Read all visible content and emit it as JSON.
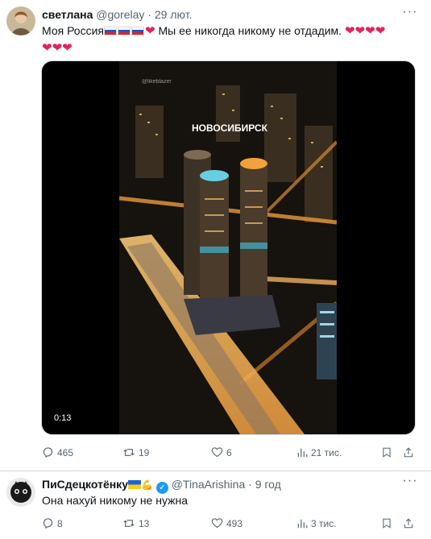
{
  "tweet1": {
    "name": "светлана",
    "handle": "@gorelay",
    "dot": "·",
    "time": "29 лют.",
    "text_part1": "Моя Россия",
    "text_part2": " Мы ее никогда никому не отдадим.",
    "media": {
      "city_label": "НОВОСИБИРСК",
      "watermark": "@likeblazer",
      "timer": "0:13"
    },
    "stats": {
      "replies": "465",
      "retweets": "19",
      "likes": "6",
      "views": "21 тис."
    }
  },
  "tweet2": {
    "name": "ПиСдецкотёнку",
    "handle": "@TinaArishina",
    "dot": "·",
    "time": "9 год",
    "text": "Она нахуй никому не нужна",
    "stats": {
      "replies": "8",
      "retweets": "13",
      "likes": "493",
      "views": "3 тис."
    }
  },
  "colors": {
    "like": "#e0245e",
    "verified": "#1d9bf0",
    "muted": "#536471"
  },
  "icons": [
    "reply-icon",
    "retweet-icon",
    "like-icon",
    "views-icon",
    "bookmark-icon",
    "share-icon",
    "more-icon",
    "verified-badge-icon"
  ]
}
